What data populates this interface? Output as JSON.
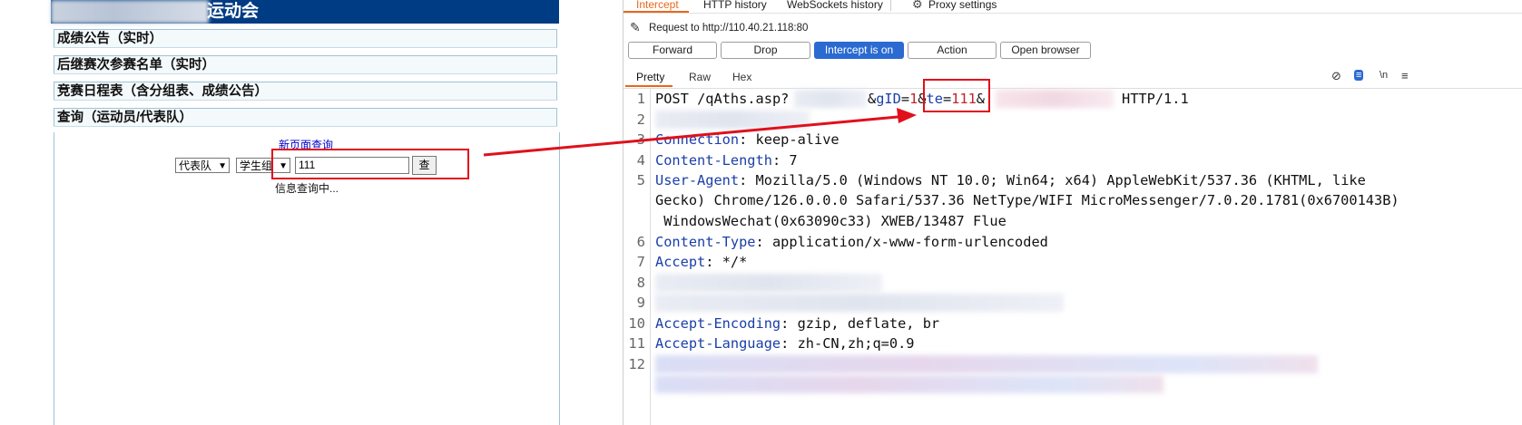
{
  "left": {
    "banner_title": "运动会",
    "sections": [
      "成绩公告（实时）",
      "后继赛次参赛名单（实时）",
      "竞赛日程表（含分组表、成绩公告）",
      "查询（运动员/代表队）"
    ],
    "new_query_link": "新页面查询",
    "select_type": "代表队",
    "select_group": "学生组",
    "query_input_value": "111",
    "query_button": "查",
    "status_text": "信息查询中..."
  },
  "right": {
    "tabs": [
      "Intercept",
      "HTTP history",
      "WebSockets history",
      "Proxy settings"
    ],
    "request_to": "Request to http://110.40.21.118:80",
    "buttons": [
      "Forward",
      "Drop",
      "Intercept is on",
      "Action",
      "Open browser"
    ],
    "subtabs": [
      "Pretty",
      "Raw",
      "Hex"
    ],
    "toolbar_icons": [
      "eye-slash-icon",
      "wrap-icon",
      "newline-icon",
      "menu-icon"
    ],
    "request": {
      "method": "POST",
      "path": "/qAths.asp?",
      "param_gid_key": "gID",
      "param_gid_val": "1",
      "param_te_key": "te",
      "param_te_val": "111",
      "protocol": "HTTP/1.1",
      "headers": [
        {
          "line": "3",
          "name": "Connection",
          "value": " keep-alive"
        },
        {
          "line": "4",
          "name": "Content-Length",
          "value": " 7"
        },
        {
          "line": "5",
          "name": "User-Agent",
          "value": " Mozilla/5.0 (Windows NT 10.0; Win64; x64) AppleWebKit/537.36 (KHTML, like"
        },
        {
          "line": "6",
          "name": "Content-Type",
          "value": " application/x-www-form-urlencoded"
        },
        {
          "line": "7",
          "name": "Accept",
          "value": " */*"
        },
        {
          "line": "10",
          "name": "Accept-Encoding",
          "value": " gzip, deflate, br"
        },
        {
          "line": "11",
          "name": "Accept-Language",
          "value": " zh-CN,zh;q=0.9"
        }
      ],
      "ua_cont_1": "Gecko) Chrome/126.0.0.0 Safari/537.36 NetType/WIFI MicroMessenger/7.0.20.1781(0x6700143B)",
      "ua_cont_2": " WindowsWechat(0x63090c33) XWEB/13487 Flue"
    },
    "line_numbers": [
      "1",
      "2",
      "3",
      "4",
      "5",
      "6",
      "7",
      "8",
      "9",
      "10",
      "11",
      "12"
    ]
  },
  "colors": {
    "banner": "#003c84",
    "intercept_on": "#2b6ad1",
    "active_tab": "#e8681a",
    "highlight": "#e0101b"
  }
}
